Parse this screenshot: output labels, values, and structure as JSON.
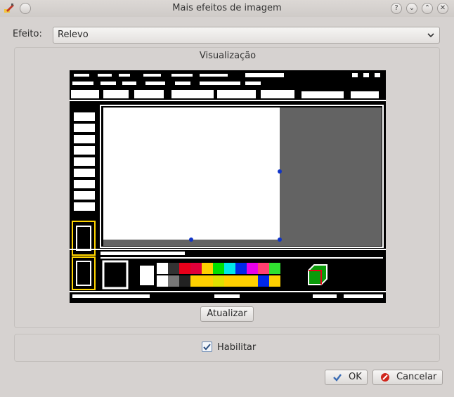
{
  "window": {
    "title": "Mais efeitos de imagem"
  },
  "titlebar_buttons": [
    "?",
    "⌄",
    "⌃",
    "✕"
  ],
  "effect": {
    "label": "Efeito:",
    "value": "Relevo"
  },
  "preview": {
    "title": "Visualização"
  },
  "update_button": "Atualizar",
  "enable": {
    "label": "Habilitar",
    "checked": true
  },
  "buttons": {
    "ok": "OK",
    "cancel": "Cancelar"
  }
}
